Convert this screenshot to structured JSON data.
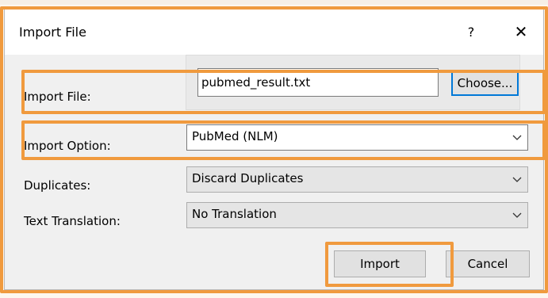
{
  "dialog": {
    "title": "Import File",
    "help_label": "?",
    "close_label": "✕"
  },
  "import_file": {
    "label": "Import File:",
    "value": "pubmed_result.txt",
    "choose_label": "Choose..."
  },
  "import_option": {
    "label": "Import Option:",
    "selected": "PubMed (NLM)"
  },
  "duplicates": {
    "label": "Duplicates:",
    "selected": "Discard Duplicates"
  },
  "text_translation": {
    "label": "Text Translation:",
    "selected": "No Translation"
  },
  "buttons": {
    "import_label": "Import",
    "cancel_label": "Cancel"
  },
  "colors": {
    "highlight": "#f09a3e",
    "focus": "#0078d7"
  }
}
